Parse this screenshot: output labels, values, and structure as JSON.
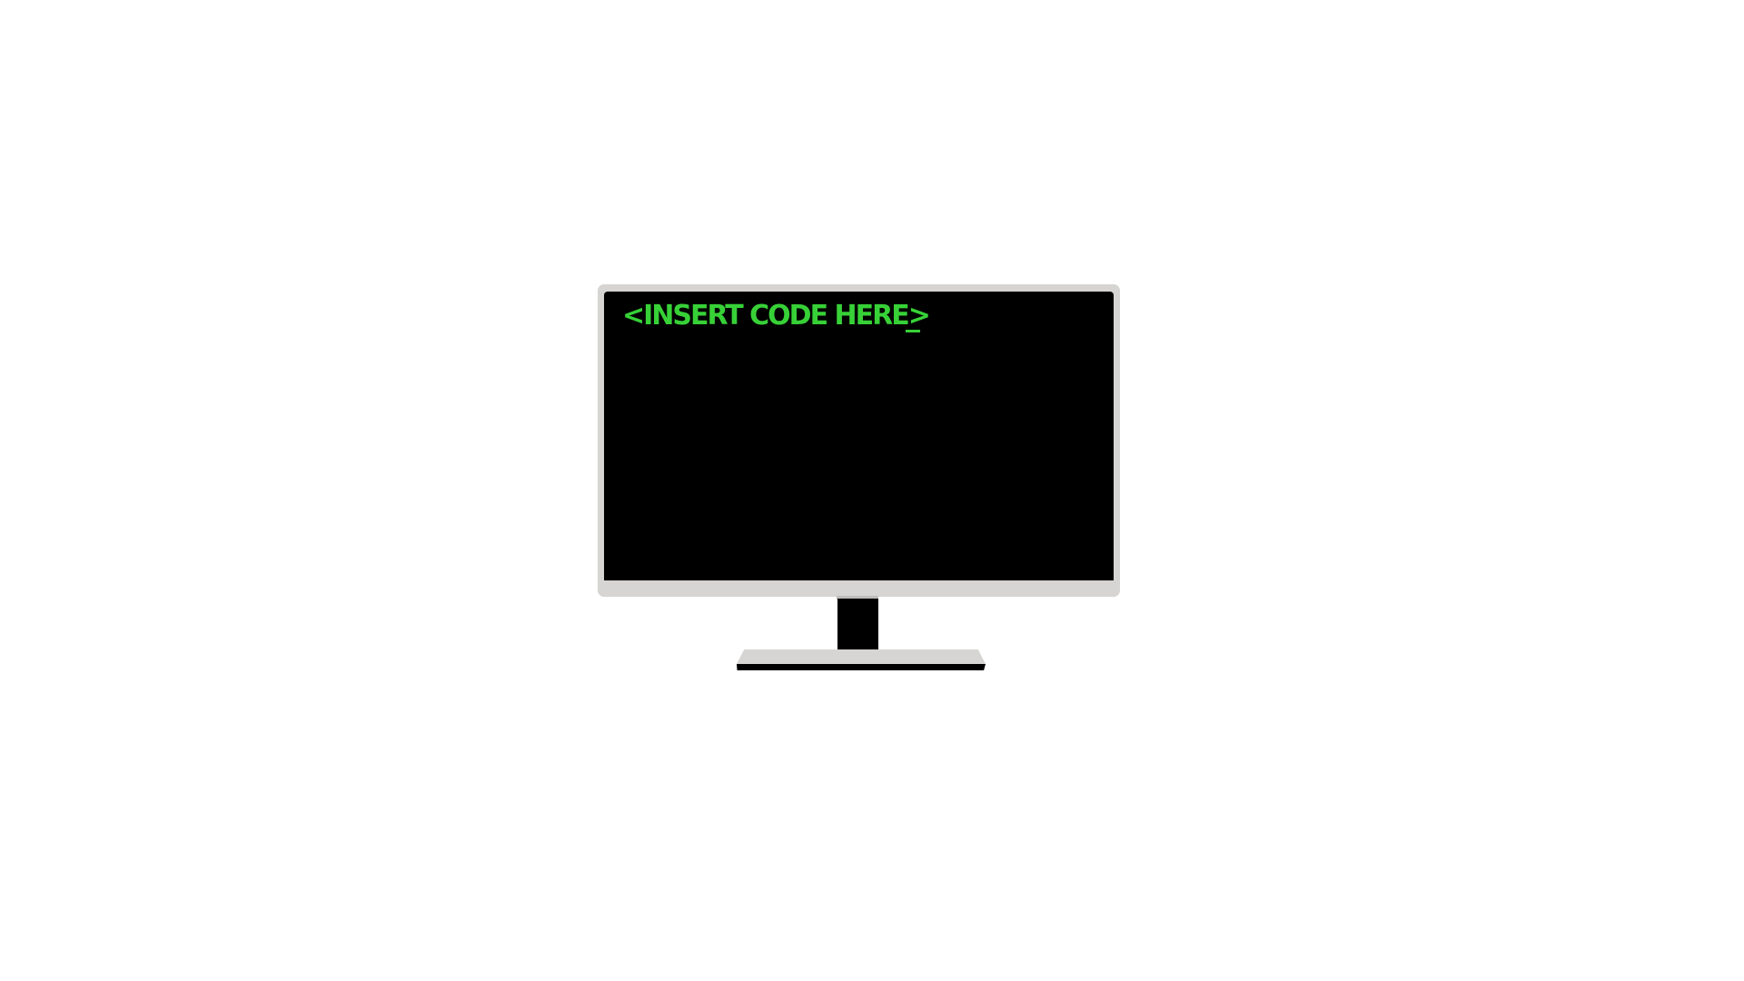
{
  "terminal": {
    "prompt_text": "<INSERT CODE HERE>",
    "cursor_glyph": "_",
    "text_color": "#37d137"
  },
  "colors": {
    "background": "#ffffff",
    "bezel": "#d6d5d3",
    "screen": "#000000"
  },
  "icons": {
    "device": "monitor-icon"
  }
}
